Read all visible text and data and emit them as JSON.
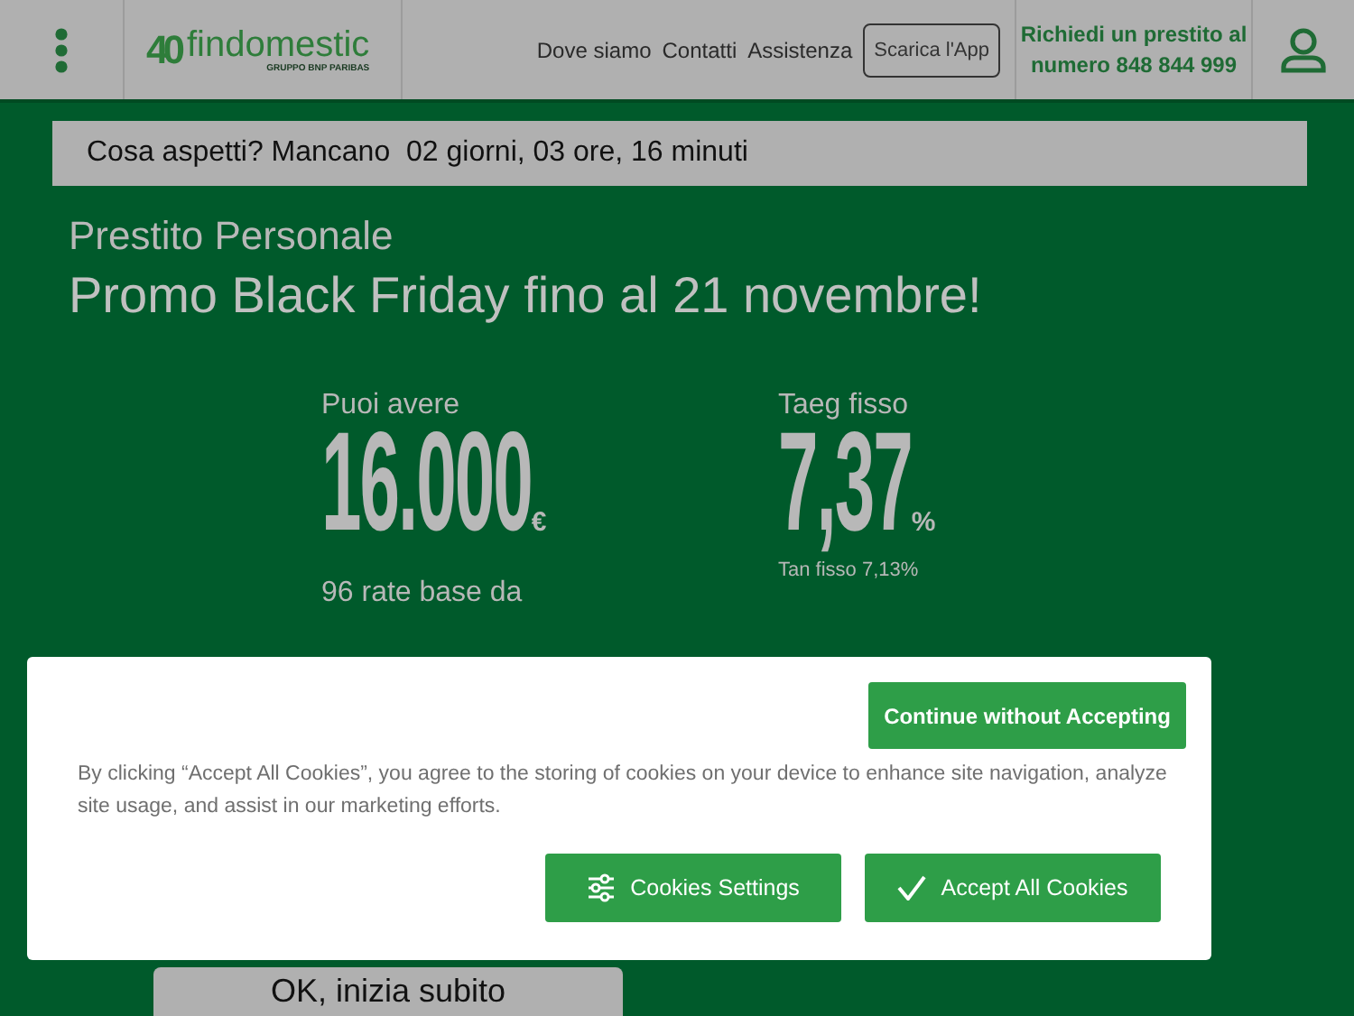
{
  "header": {
    "logo": {
      "anniversary": "40",
      "brand": "findomestic",
      "group": "GRUPPO BNP PARIBAS"
    },
    "nav": [
      "Dove siamo",
      "Contatti",
      "Assistenza"
    ],
    "app_button": "Scarica l'App",
    "phone_text": [
      "Richiedi un prestito al",
      "numero 848 844 999"
    ]
  },
  "countdown": "Cosa aspetti? Mancano  02 giorni, 03 ore, 16 minuti",
  "subtitle": "Prestito Personale",
  "title": "Promo Black Friday fino al 21 novembre!",
  "offer": [
    {
      "label": "Puoi avere",
      "value": "16.000",
      "unit": "€",
      "note": "96 rate base da"
    },
    {
      "label": "Taeg fisso",
      "value": "7,37",
      "unit": "%",
      "note": "Tan fisso 7,13%"
    }
  ],
  "cta": "OK, inizia subito",
  "cookie_banner": {
    "continue_button": "Continue without Accepting",
    "text": "By clicking “Accept All Cookies”, you agree to the storing of cookies on your device to enhance site navigation, analyze site usage, and assist in our marketing efforts.",
    "settings_button": "Cookies Settings",
    "accept_button": "Accept All Cookies"
  }
}
